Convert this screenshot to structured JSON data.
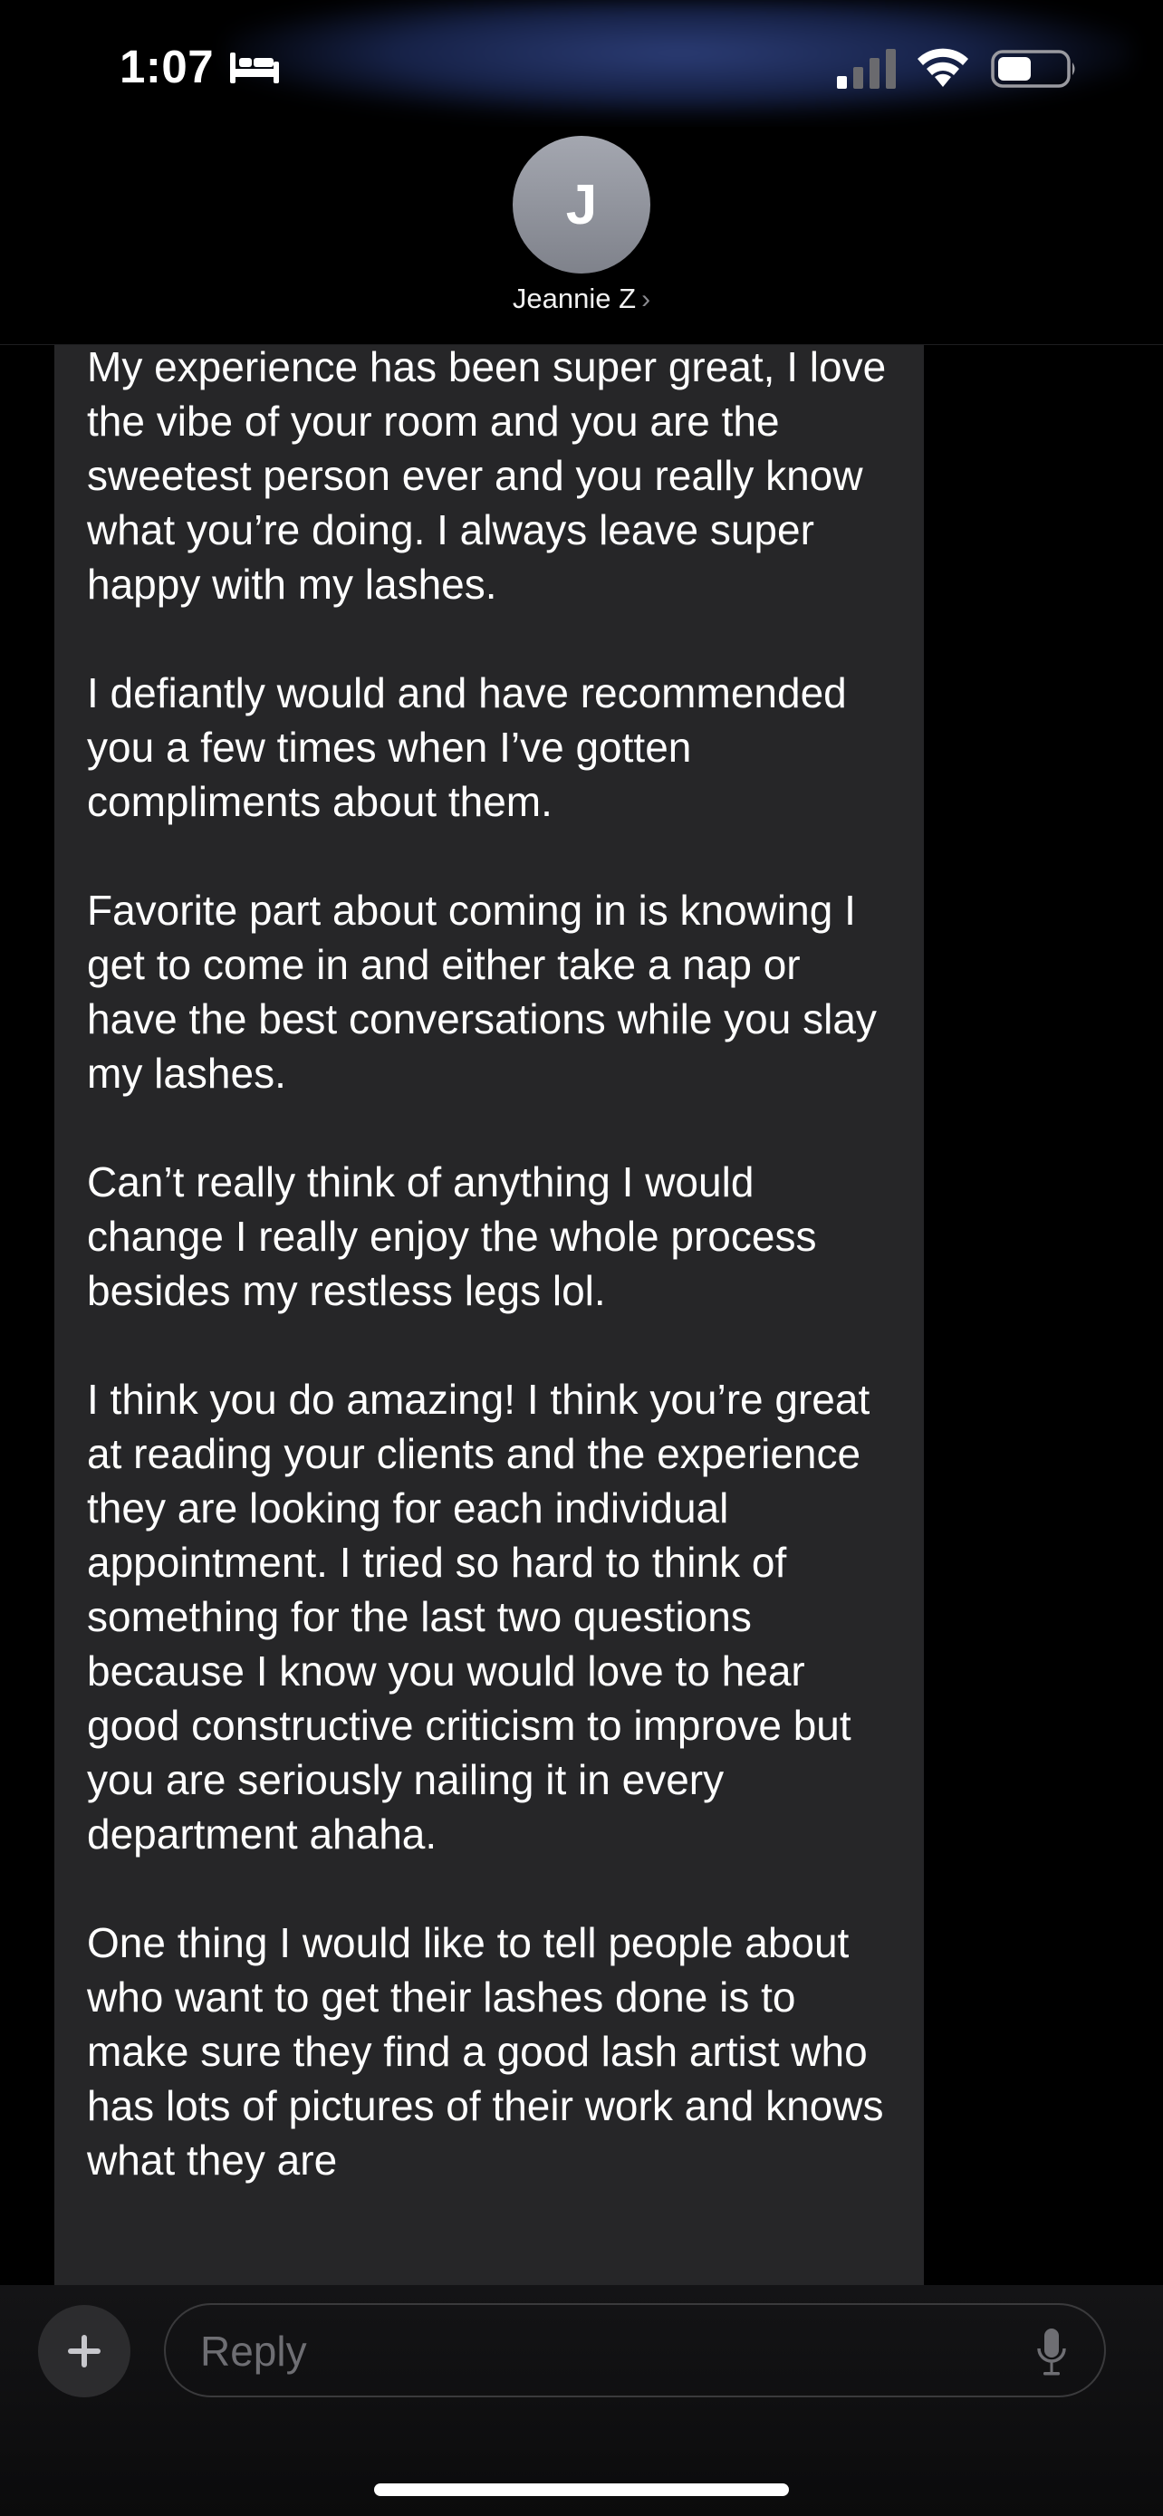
{
  "status_bar": {
    "time": "1:07",
    "sleep_icon": "bed-icon",
    "signal_icon": "cellular-signal-icon",
    "wifi_icon": "wifi-icon",
    "battery_icon": "battery-icon",
    "battery_level": 0.5
  },
  "header": {
    "avatar_initial": "J",
    "contact_name": "Jeannie Z",
    "chevron": "›"
  },
  "message": {
    "paragraphs": [
      "My experience has been super great, I love the vibe of your room and you are the sweetest person ever and you really know what you’re doing. I always leave super happy with my lashes.",
      "I defiantly would and have recommended you a few times when I’ve gotten compliments about them.",
      "Favorite part about coming in is knowing I get to come in and either take a nap or have the best conversations while you slay my lashes.",
      "Can’t really think of anything I would change I really enjoy the whole process besides my restless legs lol.",
      "I think you do amazing! I think you’re great at reading your clients and the experience they are looking for each individual appointment. I tried so hard to think of something for the last two questions because I know you would love to hear good constructive criticism to improve but you are seriously nailing it in every department ahaha.",
      "One thing I would like to tell people about who want to get their lashes done is to make sure they find a good lash artist who has lots of pictures of their work and knows what they are"
    ]
  },
  "compose": {
    "plus_icon": "plus-icon",
    "placeholder": "Reply",
    "mic_icon": "microphone-icon"
  },
  "colors": {
    "background": "#000000",
    "bubble": "#262628",
    "text": "#ffffff",
    "placeholder": "#6e6e73",
    "avatar": "#8f929b"
  }
}
